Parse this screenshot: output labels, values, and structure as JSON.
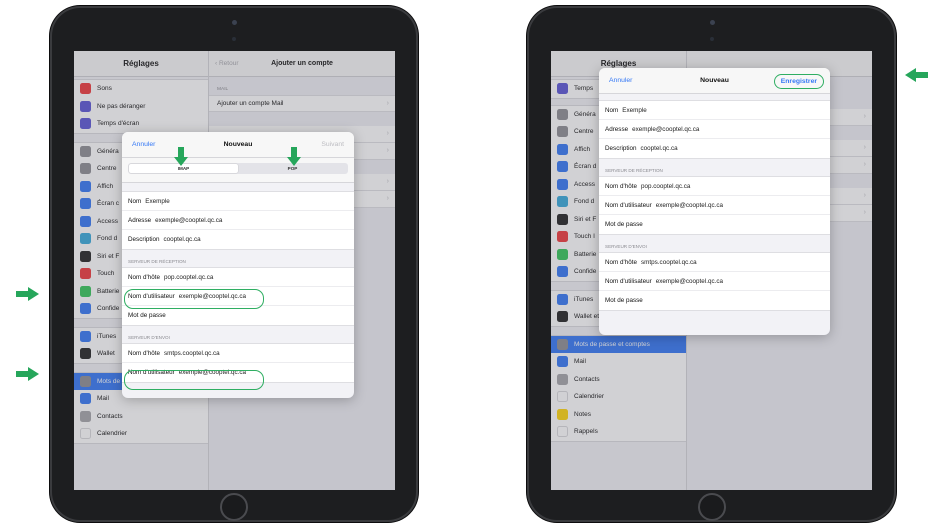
{
  "colors": {
    "accent": "#3478f6",
    "highlight": "#2fae62",
    "arrow": "#26a65b",
    "selected_row": "#3478f6"
  },
  "left": {
    "sidebar": {
      "title": "Réglages",
      "group1": [
        {
          "label": "Sons",
          "icon": "speaker-icon",
          "color": "#f0383b"
        },
        {
          "label": "Ne pas déranger",
          "icon": "moon-icon",
          "color": "#5b55d6"
        },
        {
          "label": "Temps d'écran",
          "icon": "hourglass-icon",
          "color": "#5b55d6"
        }
      ],
      "group2": [
        {
          "label": "Généra",
          "icon": "gear-icon",
          "color": "#8e8e93"
        },
        {
          "label": "Centre",
          "icon": "switches-icon",
          "color": "#8e8e93"
        },
        {
          "label": "Affich",
          "icon": "text-size-icon",
          "color": "#3478f6"
        },
        {
          "label": "Écran c",
          "icon": "grid-icon",
          "color": "#3478f6"
        },
        {
          "label": "Access",
          "icon": "accessibility-icon",
          "color": "#3478f6"
        },
        {
          "label": "Fond d",
          "icon": "flower-icon",
          "color": "#36aadc"
        },
        {
          "label": "Siri et F",
          "icon": "siri-icon",
          "color": "#222222"
        },
        {
          "label": "Touch",
          "icon": "fingerprint-icon",
          "color": "#f0383b"
        },
        {
          "label": "Batterie",
          "icon": "battery-icon",
          "color": "#34c759"
        },
        {
          "label": "Confide",
          "icon": "hand-icon",
          "color": "#3478f6"
        }
      ],
      "group3": [
        {
          "label": "iTunes",
          "icon": "app-store-icon",
          "color": "#3478f6"
        },
        {
          "label": "Wallet",
          "icon": "wallet-icon",
          "color": "#222222"
        }
      ],
      "group4": [
        {
          "label": "Mots de passe et comptes",
          "icon": "key-icon",
          "color": "#8e8e93",
          "selected": true
        },
        {
          "label": "Mail",
          "icon": "mail-icon",
          "color": "#3478f6"
        },
        {
          "label": "Contacts",
          "icon": "contacts-icon",
          "color": "#a5a5aa"
        },
        {
          "label": "Calendrier",
          "icon": "calendar-icon",
          "color": "#ffffff"
        }
      ]
    },
    "detail": {
      "back": "Retour",
      "title": "Ajouter un compte",
      "caption": "MAIL",
      "row": "Ajouter un compte Mail"
    },
    "modal": {
      "cancel": "Annuler",
      "title": "Nouveau",
      "next": "Suivant",
      "segments": [
        "IMAP",
        "POP"
      ],
      "fields": [
        {
          "key": "Nom",
          "value": "Exemple"
        },
        {
          "key": "Adresse",
          "value": "exemple@cooptel.qc.ca"
        },
        {
          "key": "Description",
          "value": "cooptel.qc.ca"
        }
      ],
      "incoming_caption": "SERVEUR DE RÉCEPTION",
      "incoming": [
        {
          "key": "Nom d'hôte",
          "value": "pop.cooptel.qc.ca"
        },
        {
          "key": "Nom d'utilisateur",
          "value": "exemple@cooptel.qc.ca"
        },
        {
          "key": "Mot de passe",
          "value": ""
        }
      ],
      "outgoing_caption": "SERVEUR D'ENVOI",
      "outgoing": [
        {
          "key": "Nom d'hôte",
          "value": "smtps.cooptel.qc.ca"
        },
        {
          "key": "Nom d'utilisateur",
          "value": "exemple@cooptel.qc.ca"
        }
      ]
    }
  },
  "right": {
    "sidebar": {
      "title": "Réglages",
      "group1": [
        {
          "label": "Temps",
          "icon": "hourglass-icon",
          "color": "#5b55d6"
        }
      ],
      "group2": [
        {
          "label": "Généra",
          "icon": "gear-icon",
          "color": "#8e8e93"
        },
        {
          "label": "Centre",
          "icon": "switches-icon",
          "color": "#8e8e93"
        },
        {
          "label": "Affich",
          "icon": "text-size-icon",
          "color": "#3478f6"
        },
        {
          "label": "Écran d",
          "icon": "grid-icon",
          "color": "#3478f6"
        },
        {
          "label": "Access",
          "icon": "accessibility-icon",
          "color": "#3478f6"
        },
        {
          "label": "Fond d",
          "icon": "flower-icon",
          "color": "#36aadc"
        },
        {
          "label": "Siri et F",
          "icon": "siri-icon",
          "color": "#222222"
        },
        {
          "label": "Touch I",
          "icon": "fingerprint-icon",
          "color": "#f0383b"
        },
        {
          "label": "Batterie",
          "icon": "battery-icon",
          "color": "#34c759"
        },
        {
          "label": "Confide",
          "icon": "hand-icon",
          "color": "#3478f6"
        }
      ],
      "group3": [
        {
          "label": "iTunes",
          "icon": "app-store-icon",
          "color": "#3478f6"
        },
        {
          "label": "Wallet et Apple Pay",
          "icon": "wallet-icon",
          "color": "#222222"
        }
      ],
      "group4": [
        {
          "label": "Mots de passe et comptes",
          "icon": "key-icon",
          "color": "#8e8e93",
          "selected": true
        },
        {
          "label": "Mail",
          "icon": "mail-icon",
          "color": "#3478f6"
        },
        {
          "label": "Contacts",
          "icon": "contacts-icon",
          "color": "#a5a5aa"
        },
        {
          "label": "Calendrier",
          "icon": "calendar-icon",
          "color": "#ffffff"
        },
        {
          "label": "Notes",
          "icon": "notes-icon",
          "color": "#ffd60a"
        },
        {
          "label": "Rappels",
          "icon": "reminders-icon",
          "color": "#ffffff"
        }
      ]
    },
    "modal": {
      "cancel": "Annuler",
      "title": "Nouveau",
      "save": "Enregistrer",
      "fields": [
        {
          "key": "Nom",
          "value": "Exemple"
        },
        {
          "key": "Adresse",
          "value": "exemple@cooptel.qc.ca"
        },
        {
          "key": "Description",
          "value": "cooptel.qc.ca"
        }
      ],
      "incoming_caption": "SERVEUR DE RÉCEPTION",
      "incoming": [
        {
          "key": "Nom d'hôte",
          "value": "pop.cooptel.qc.ca"
        },
        {
          "key": "Nom d'utilisateur",
          "value": "exemple@cooptel.qc.ca"
        },
        {
          "key": "Mot de passe",
          "value": ""
        }
      ],
      "outgoing_caption": "SERVEUR D'ENVOI",
      "outgoing": [
        {
          "key": "Nom d'hôte",
          "value": "smtps.cooptel.qc.ca"
        },
        {
          "key": "Nom d'utilisateur",
          "value": "exemple@cooptel.qc.ca"
        },
        {
          "key": "Mot de passe",
          "value": ""
        }
      ]
    }
  }
}
